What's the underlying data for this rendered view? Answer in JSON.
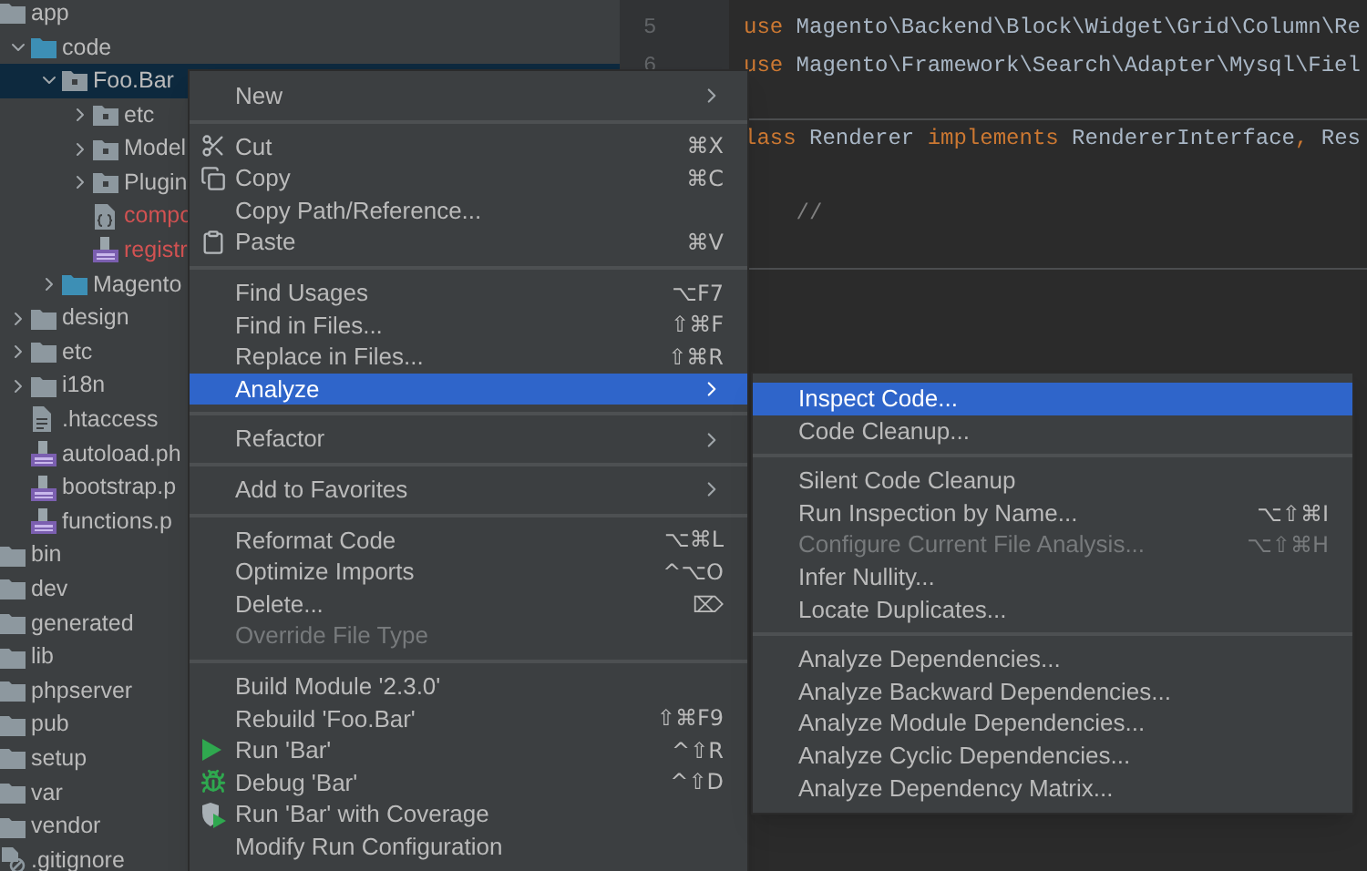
{
  "project_tree": [
    {
      "name": "app",
      "kind": "folder",
      "children": [
        {
          "name": "code",
          "kind": "source",
          "expanded": true,
          "children": [
            {
              "name": "Foo.Bar",
              "kind": "module",
              "expanded": true,
              "selected": true,
              "children": [
                {
                  "name": "etc",
                  "kind": "module",
                  "expanded": false
                },
                {
                  "name": "Model",
                  "kind": "module",
                  "expanded": false
                },
                {
                  "name": "Plugin",
                  "kind": "module",
                  "expanded": false
                },
                {
                  "name": "compo",
                  "kind": "json",
                  "untracked": true
                },
                {
                  "name": "registr",
                  "kind": "php",
                  "untracked": true
                }
              ]
            },
            {
              "name": "Magento",
              "kind": "source",
              "expanded": false
            }
          ]
        },
        {
          "name": "design",
          "kind": "folder",
          "expanded": false
        },
        {
          "name": "etc",
          "kind": "folder",
          "expanded": false
        },
        {
          "name": "i18n",
          "kind": "folder",
          "expanded": false
        },
        {
          "name": ".htaccess",
          "kind": "file"
        },
        {
          "name": "autoload.ph",
          "kind": "php"
        },
        {
          "name": "bootstrap.p",
          "kind": "php"
        },
        {
          "name": "functions.p",
          "kind": "php"
        }
      ]
    },
    {
      "name": "bin",
      "kind": "folder"
    },
    {
      "name": "dev",
      "kind": "folder"
    },
    {
      "name": "generated",
      "kind": "folder"
    },
    {
      "name": "lib",
      "kind": "folder"
    },
    {
      "name": "phpserver",
      "kind": "folder"
    },
    {
      "name": "pub",
      "kind": "folder"
    },
    {
      "name": "setup",
      "kind": "folder"
    },
    {
      "name": "var",
      "kind": "folder"
    },
    {
      "name": "vendor",
      "kind": "folder"
    },
    {
      "name": ".gitignore",
      "kind": "gitignore"
    }
  ],
  "editor": {
    "lines": [
      {
        "number": "5",
        "tokens": [
          {
            "kind": "keyword",
            "text": "use"
          },
          {
            "kind": "plain",
            "text": " Magento\\Backend\\Block\\Widget\\Grid\\Column\\Re"
          }
        ]
      },
      {
        "number": "6",
        "tokens": [
          {
            "kind": "keyword",
            "text": "use"
          },
          {
            "kind": "plain",
            "text": " Magento\\Framework\\Search\\Adapter\\Mysql\\Fiel"
          }
        ]
      },
      {
        "divider": true
      },
      {
        "tokens": [
          {
            "kind": "keyword",
            "text": "lass"
          },
          {
            "kind": "plain",
            "text": " Renderer "
          },
          {
            "kind": "keyword",
            "text": "implements"
          },
          {
            "kind": "plain",
            "text": " RendererInterface"
          },
          {
            "kind": "keyword",
            "text": ","
          },
          {
            "kind": "plain",
            "text": " Res"
          }
        ]
      },
      {
        "divider": false
      },
      {
        "tokens": [
          {
            "kind": "comment",
            "text": "    //"
          }
        ]
      },
      {
        "divider": true
      }
    ]
  },
  "context_menu": {
    "items": [
      {
        "kind": "item",
        "label": "New",
        "submenu": true
      },
      {
        "kind": "separator"
      },
      {
        "kind": "item",
        "label": "Cut",
        "shortcut": "⌘X"
      },
      {
        "kind": "item",
        "label": "Copy",
        "shortcut": "⌘C"
      },
      {
        "kind": "item",
        "label": "Copy Path/Reference..."
      },
      {
        "kind": "item",
        "label": "Paste",
        "shortcut": "⌘V"
      },
      {
        "kind": "separator"
      },
      {
        "kind": "item",
        "label": "Find Usages",
        "shortcut": "⌥F7"
      },
      {
        "kind": "item",
        "label": "Find in Files...",
        "shortcut": "⇧⌘F"
      },
      {
        "kind": "item",
        "label": "Replace in Files...",
        "shortcut": "⇧⌘R"
      },
      {
        "kind": "item",
        "label": "Analyze",
        "submenu": true,
        "selected": true
      },
      {
        "kind": "separator"
      },
      {
        "kind": "item",
        "label": "Refactor",
        "submenu": true
      },
      {
        "kind": "separator"
      },
      {
        "kind": "item",
        "label": "Add to Favorites",
        "submenu": true
      },
      {
        "kind": "separator"
      },
      {
        "kind": "item",
        "label": "Reformat Code",
        "shortcut": "⌥⌘L"
      },
      {
        "kind": "item",
        "label": "Optimize Imports",
        "shortcut": "^⌥O"
      },
      {
        "kind": "item",
        "label": "Delete...",
        "shortcut": "⌦"
      },
      {
        "kind": "item",
        "label": "Override File Type",
        "disabled": true
      },
      {
        "kind": "separator"
      },
      {
        "kind": "item",
        "label": "Build Module '2.3.0'"
      },
      {
        "kind": "item",
        "label": "Rebuild 'Foo.Bar'",
        "shortcut": "⇧⌘F9"
      },
      {
        "kind": "item",
        "label": "Run 'Bar'",
        "shortcut": "^⇧R"
      },
      {
        "kind": "item",
        "label": "Debug 'Bar'",
        "shortcut": "^⇧D"
      },
      {
        "kind": "item",
        "label": "Run 'Bar' with Coverage"
      },
      {
        "kind": "item",
        "label": "Modify Run Configuration"
      }
    ]
  },
  "analyze_submenu": {
    "items": [
      {
        "kind": "item",
        "label": "Inspect Code...",
        "selected": true
      },
      {
        "kind": "item",
        "label": "Code Cleanup..."
      },
      {
        "kind": "separator"
      },
      {
        "kind": "item",
        "label": "Silent Code Cleanup"
      },
      {
        "kind": "item",
        "label": "Run Inspection by Name...",
        "shortcut": "⌥⇧⌘I"
      },
      {
        "kind": "item",
        "label": "Configure Current File Analysis...",
        "shortcut": "⌥⇧⌘H",
        "disabled": true
      },
      {
        "kind": "item",
        "label": "Infer Nullity..."
      },
      {
        "kind": "item",
        "label": "Locate Duplicates..."
      },
      {
        "kind": "separator"
      },
      {
        "kind": "item",
        "label": "Analyze Dependencies..."
      },
      {
        "kind": "item",
        "label": "Analyze Backward Dependencies..."
      },
      {
        "kind": "item",
        "label": "Analyze Module Dependencies..."
      },
      {
        "kind": "item",
        "label": "Analyze Cyclic Dependencies..."
      },
      {
        "kind": "item",
        "label": "Analyze Dependency Matrix..."
      }
    ]
  }
}
